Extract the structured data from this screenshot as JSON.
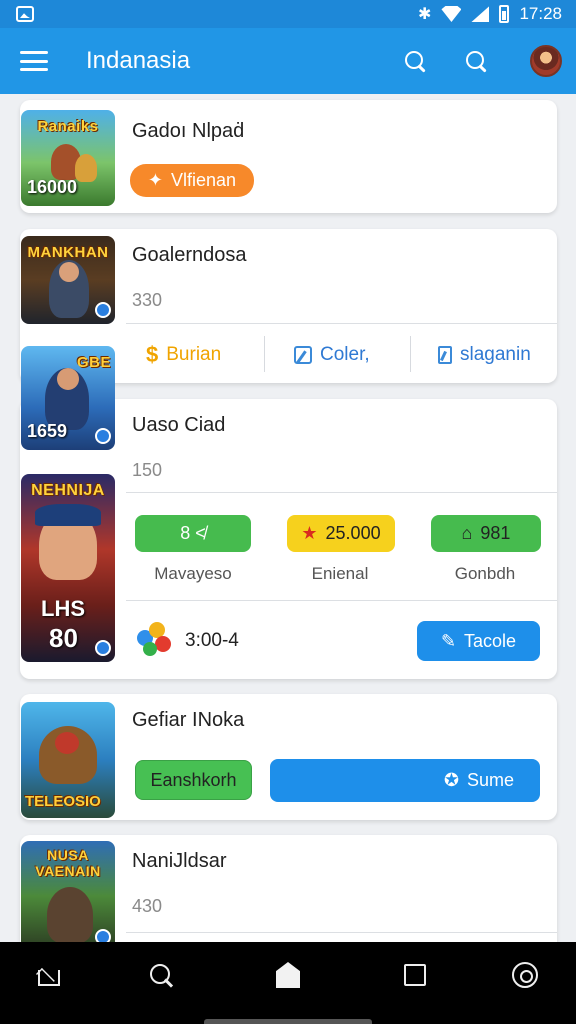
{
  "status_bar": {
    "time": "17:28"
  },
  "app_bar": {
    "title": "Indanasia"
  },
  "cards": [
    {
      "title": "Gadoı Nlpaḋ",
      "thumb_top": "Ranaiks",
      "thumb_bottom": "16000",
      "button": {
        "label": "Vlfienan",
        "icon": "star-icon"
      }
    },
    {
      "title": "Goalerndosa",
      "subtitle": "330",
      "thumb_top": "MANKHAN",
      "actions": [
        {
          "label": "Burian",
          "icon": "dollar-icon",
          "color": "#f0a400"
        },
        {
          "label": "Coler,",
          "icon": "edit-icon",
          "color": "#2f79d3"
        },
        {
          "label": "slaganin",
          "icon": "doc-icon",
          "color": "#2f79d3"
        }
      ]
    },
    {
      "title": "Uaso Ciad",
      "subtitle": "150",
      "thumb_top": "GBE",
      "thumb_bottom": "1659",
      "thumb2_top": "NEHNIJA",
      "thumb2_mid": "LHS",
      "thumb2_bottom": "80",
      "stats": [
        {
          "value": "8 ≮",
          "label": "Mavayeso",
          "color": "#46bb4e"
        },
        {
          "value": "25.000",
          "label": "Enienal",
          "color": "#f6d11d"
        },
        {
          "value": "981",
          "label": "Gonbdh",
          "color": "#46bb4e"
        }
      ],
      "footer_value": "3:00-4",
      "footer_button": "Tacole"
    },
    {
      "title": "Gefiar INoka",
      "thumb_bottom": "TELEOSIO",
      "button_left": "Eanshkorh",
      "button_right": "Sume"
    },
    {
      "title": "NaniJldsar",
      "subtitle": "430",
      "thumb_top": "NUSA VAENAIN"
    }
  ]
}
